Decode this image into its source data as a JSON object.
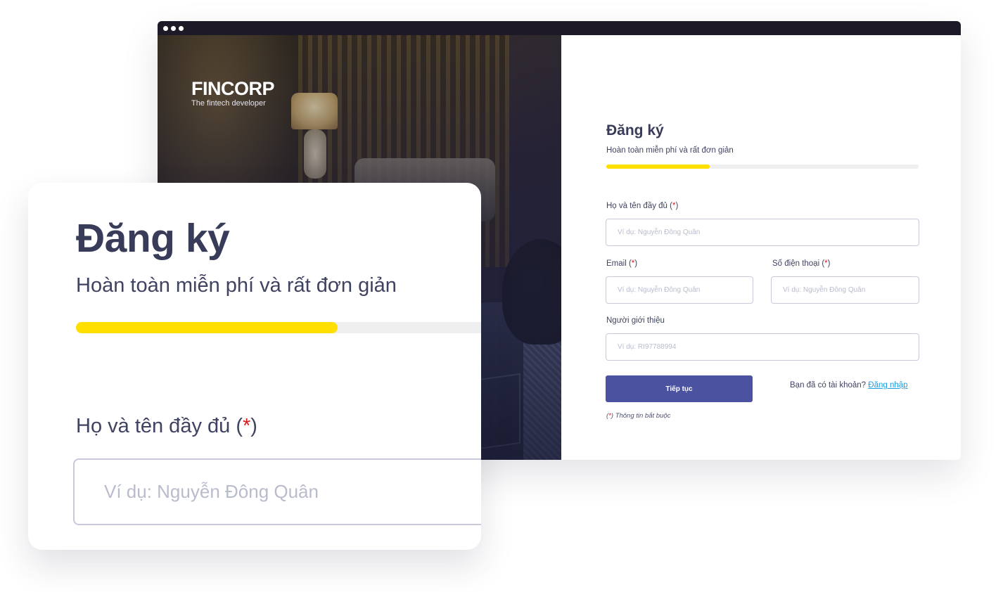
{
  "brand": {
    "name": "FINCORP",
    "tagline": "The fintech developer"
  },
  "form": {
    "title": "Đăng ký",
    "subtitle": "Hoàn toàn miễn phí và rất đơn giản",
    "progress": 0.33,
    "required_mark": "*",
    "fields": {
      "full_name": {
        "label": "Họ và tên đầy đủ",
        "placeholder": "Ví dụ: Nguyễn Đông Quân"
      },
      "email": {
        "label": "Email",
        "placeholder": "Ví dụ: Nguyễn Đông Quân"
      },
      "phone": {
        "label": "Số điện thoại",
        "placeholder": "Ví dụ: Nguyễn Đông Quân"
      },
      "referrer": {
        "label": "Người giới thiệu",
        "placeholder": "Ví dụ: RI97788994"
      }
    },
    "submit_label": "Tiếp tục",
    "have_account_text": "Bạn đã có tài khoản?",
    "login_link": "Đăng nhập",
    "required_note": "Thông tin bắt buộc"
  },
  "zoom_card": {
    "title": "Đăng ký",
    "subtitle": "Hoàn toàn miễn phí và rất đơn giản",
    "progress": 0.6,
    "field_label": "Họ và tên đầy đủ",
    "field_placeholder": "Ví dụ: Nguyễn Đông Quân"
  },
  "colors": {
    "accent_yellow": "#ffdf00",
    "primary_button": "#4b52a0",
    "required": "#e0191d",
    "link": "#1d9fe0",
    "text_dark": "#383c59"
  }
}
